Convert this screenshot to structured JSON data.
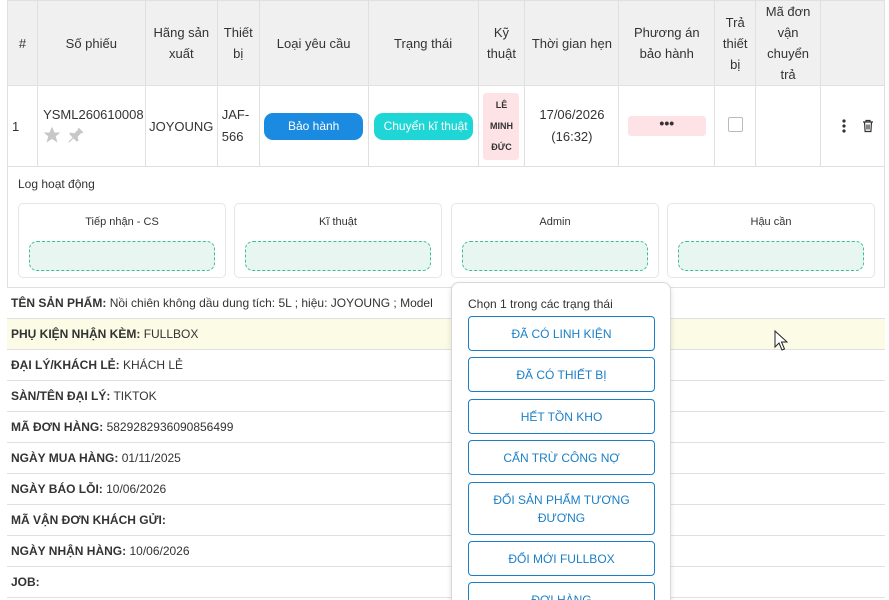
{
  "table": {
    "headers": [
      "#",
      "Số phiếu",
      "Hãng sản xuất",
      "Thiết bị",
      "Loại yêu cầu",
      "Trạng thái",
      "Kỹ thuật",
      "Thời gian hẹn",
      "Phương án bảo hành",
      "Trả thiết bị",
      "Mã đơn vận chuyển trả"
    ],
    "row": {
      "num": "1",
      "ticket": "YSML260610008",
      "brand": "JOYOUNG",
      "device": "JAF-566",
      "request_type": "Bảo hành",
      "status": "Chuyển kĩ thuật",
      "technician": "LÊ MINH ĐỨC",
      "appointment": "17/06/2026 (16:32)",
      "plan": "•••"
    }
  },
  "log": {
    "title": "Log hoạt động",
    "cards": [
      "Tiếp nhận - CS",
      "Kĩ thuật",
      "Admin",
      "Hậu cần"
    ]
  },
  "info": [
    {
      "label": "TÊN SẢN PHẨM:",
      "value": "Nồi chiên không dầu dung tích: 5L ; hiệu: JOYOUNG ; Model"
    },
    {
      "label": "PHỤ KIỆN NHẬN KÈM:",
      "value": "FULLBOX"
    },
    {
      "label": "ĐẠI LÝ/KHÁCH LẺ:",
      "value": "KHÁCH LẺ"
    },
    {
      "label": "SÀN/TÊN ĐẠI LÝ:",
      "value": "TIKTOK"
    },
    {
      "label": "MÃ ĐƠN HÀNG:",
      "value": "5829282936090856499"
    },
    {
      "label": "NGÀY MUA HÀNG:",
      "value": "01/11/2025"
    },
    {
      "label": "NGÀY BÁO LỖI:",
      "value": "10/06/2026"
    },
    {
      "label": "MÃ VẬN ĐƠN KHÁCH GỬI:",
      "value": ""
    },
    {
      "label": "NGÀY NHẬN HÀNG:",
      "value": "10/06/2026"
    },
    {
      "label": "JOB:",
      "value": ""
    }
  ],
  "popup": {
    "title": "Chọn 1 trong các trạng thái",
    "options": [
      "ĐÃ CÓ LINH KIỆN",
      "ĐÃ CÓ THIẾT BỊ",
      "HẾT TỒN KHO",
      "CẤN TRỪ CÔNG NỢ",
      "ĐỔI SẢN PHẨM TƯƠNG ĐƯƠNG",
      "ĐỔI MỚI FULLBOX",
      "ĐỢI HÀNG"
    ]
  },
  "colors": {
    "primary": "#1a8be0",
    "status_cyan": "#1ed6d6",
    "badge_pink": "#fde3e6",
    "option_blue": "#1a7fc7",
    "dropzone_green": "#3fbf8f"
  }
}
